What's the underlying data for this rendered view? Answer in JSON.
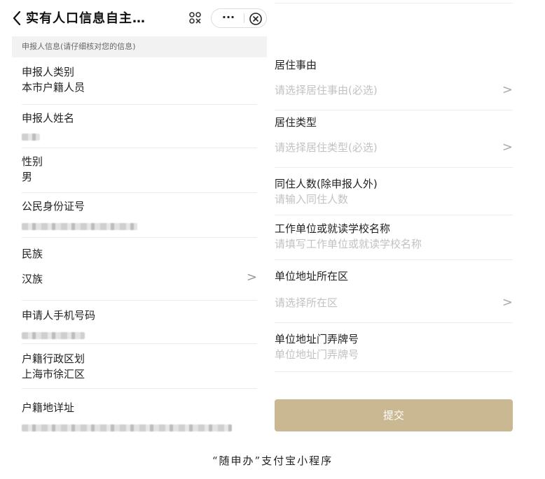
{
  "header": {
    "title": "实有人口信息自主…",
    "more_label": "···"
  },
  "section": {
    "title": "申报人信息(请仔细核对您的信息)"
  },
  "left_fields": [
    {
      "label": "申报人类别",
      "value": "本市户籍人员"
    },
    {
      "label": "申报人姓名",
      "value": ""
    },
    {
      "label": "性别",
      "value": "男"
    },
    {
      "label": "公民身份证号",
      "value": ""
    },
    {
      "label": "民族",
      "value": "汉族"
    },
    {
      "label": "申请人手机号码",
      "value": ""
    },
    {
      "label": "户籍行政区划",
      "value": "上海市徐汇区"
    },
    {
      "label": "户籍地详址",
      "value": ""
    }
  ],
  "right_fields": [
    {
      "label": "居住事由",
      "placeholder": "请选择居住事由(必选)",
      "chevron": ">"
    },
    {
      "label": "居住类型",
      "placeholder": "请选择居住类型(必选)",
      "chevron": ">"
    },
    {
      "label": "同住人数(除申报人外)",
      "placeholder": "请输入同住人数"
    },
    {
      "label": "工作单位或就读学校名称",
      "placeholder": "请填写工作单位或就读学校名称"
    },
    {
      "label": "单位地址所在区",
      "placeholder": "请选择所在区",
      "chevron": ">"
    },
    {
      "label": "单位地址门弄牌号",
      "placeholder": "单位地址门弄牌号"
    }
  ],
  "ethnicity_chevron": ">",
  "submit_label": "提交",
  "caption": "“随申办”支付宝小程序",
  "colors": {
    "submit": "#c9b891",
    "placeholder": "#c2c2c2",
    "section_bg": "#f2f2f2"
  },
  "icons": [
    "back-icon",
    "mini-program-icon",
    "more-icon",
    "close-icon",
    "chevron-right-icon"
  ]
}
